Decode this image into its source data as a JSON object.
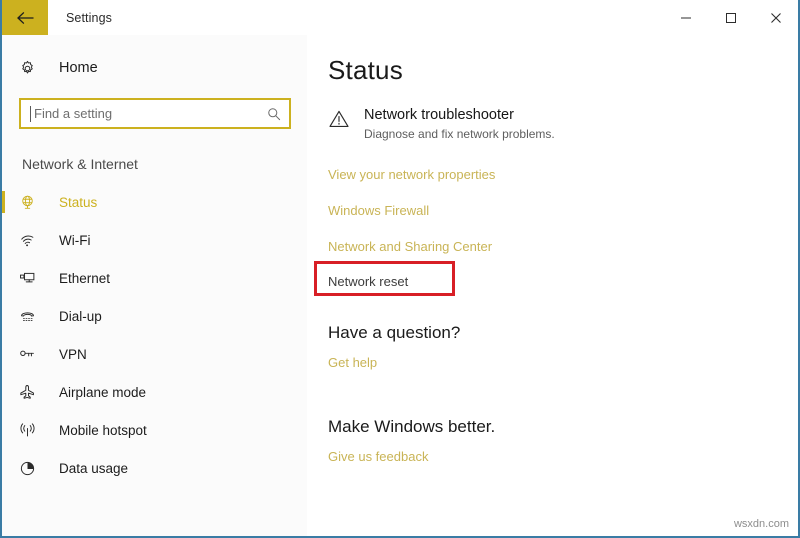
{
  "window": {
    "title": "Settings",
    "back_icon": "back-arrow-icon",
    "minimize_label": "–",
    "maximize_label": "□",
    "close_label": "✕"
  },
  "sidebar": {
    "home": {
      "label": "Home",
      "icon": "gear-icon"
    },
    "search": {
      "placeholder": "Find a setting",
      "value": "",
      "icon": "search-icon"
    },
    "section_title": "Network & Internet",
    "items": [
      {
        "label": "Status",
        "icon": "globe-status-icon",
        "selected": true
      },
      {
        "label": "Wi-Fi",
        "icon": "wifi-icon",
        "selected": false
      },
      {
        "label": "Ethernet",
        "icon": "ethernet-icon",
        "selected": false
      },
      {
        "label": "Dial-up",
        "icon": "dialup-phone-icon",
        "selected": false
      },
      {
        "label": "VPN",
        "icon": "vpn-key-icon",
        "selected": false
      },
      {
        "label": "Airplane mode",
        "icon": "airplane-icon",
        "selected": false
      },
      {
        "label": "Mobile hotspot",
        "icon": "hotspot-icon",
        "selected": false
      },
      {
        "label": "Data usage",
        "icon": "data-usage-pie-icon",
        "selected": false
      }
    ]
  },
  "main": {
    "page_title": "Status",
    "troubleshooter": {
      "icon": "warning-triangle-icon",
      "title": "Network troubleshooter",
      "description": "Diagnose and fix network problems."
    },
    "links": [
      "View your network properties",
      "Windows Firewall",
      "Network and Sharing Center"
    ],
    "network_reset": "Network reset",
    "question_heading": "Have a question?",
    "get_help": "Get help",
    "feedback_heading": "Make Windows better.",
    "give_feedback": "Give us feedback"
  },
  "watermark": "wsxdn.com",
  "colors": {
    "accent_gold": "#ccb11f",
    "link_gold": "#c9b456",
    "annotation_red": "#d81f26",
    "window_border": "#3a7ca5"
  }
}
